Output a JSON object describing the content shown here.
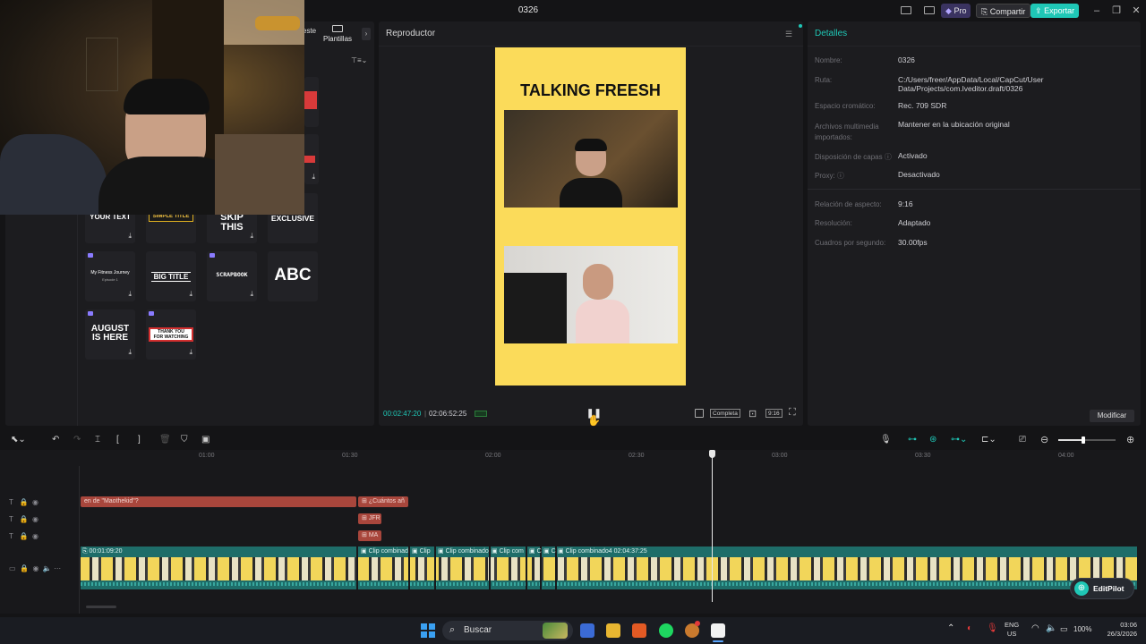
{
  "titlebar": {
    "title": "0326",
    "pro_label": "Pro",
    "share_label": "Compartir",
    "export_label": "Exportar"
  },
  "left_panel": {
    "tabs": [
      "este",
      "Plantillas"
    ],
    "tiles": [
      {
        "text": "YOUR TEXT"
      },
      {
        "text": "SIMPLE TITLE"
      },
      {
        "text": "SKIP THIS"
      },
      {
        "text": "EXCLUSIVE"
      },
      {
        "text": "My Fitness Journey",
        "subtext": "Episode 1"
      },
      {
        "text": "BIG TITLE"
      },
      {
        "text": "SCRAPBOOK"
      },
      {
        "text": "ABC"
      },
      {
        "text": "AUGUST IS HERE"
      },
      {
        "text": "THANK YOU FOR WATCHING"
      }
    ]
  },
  "player": {
    "header": "Reproductor",
    "canvas_title": "TALKING FREESH",
    "current_time": "00:02:47:20",
    "total_time": "02:06:52:25",
    "full_label": "Completa",
    "ratio_label": "9:16"
  },
  "details": {
    "header": "Detalles",
    "rows": [
      {
        "label": "Nombre:",
        "value": "0326"
      },
      {
        "label": "Ruta:",
        "value": "C:/Users/freer/AppData/Local/CapCut/User Data/Projects/com.lveditor.draft/0326"
      },
      {
        "label": "Espacio cromático:",
        "value": "Rec. 709 SDR"
      },
      {
        "label": "Archivos multimedia importados:",
        "value": "Mantener en la ubicación original"
      },
      {
        "label": "Disposición de capas",
        "value": "Activado"
      },
      {
        "label": "Proxy:",
        "value": "Desactivado"
      },
      {
        "label": "Relación de aspecto:",
        "value": "9:16"
      },
      {
        "label": "Resolución:",
        "value": "Adaptado"
      },
      {
        "label": "Cuadros por segundo:",
        "value": "30.00fps"
      }
    ],
    "modify_label": "Modificar"
  },
  "timeline": {
    "ruler": [
      "01:00",
      "01:30",
      "02:00",
      "02:30",
      "03:00",
      "03:30",
      "04:00"
    ],
    "text_clips": [
      {
        "label": "en  de \"Maothekid\"?"
      },
      {
        "label": "¿Cuántos añ"
      },
      {
        "label": "JFR"
      },
      {
        "label": "MA"
      }
    ],
    "video_labels": [
      "00:01:09:20",
      "Clip combinad",
      "Clip",
      "Clip combinado",
      "Clip com",
      "C",
      "C",
      "Clip combinado4   02:04:37:25"
    ],
    "editpilot_label": "EditPilot"
  },
  "taskbar": {
    "search_placeholder": "Buscar",
    "lang_top": "ENG",
    "lang_bottom": "US",
    "battery": "100%",
    "time": "03:06",
    "date": "26/3/2026"
  }
}
